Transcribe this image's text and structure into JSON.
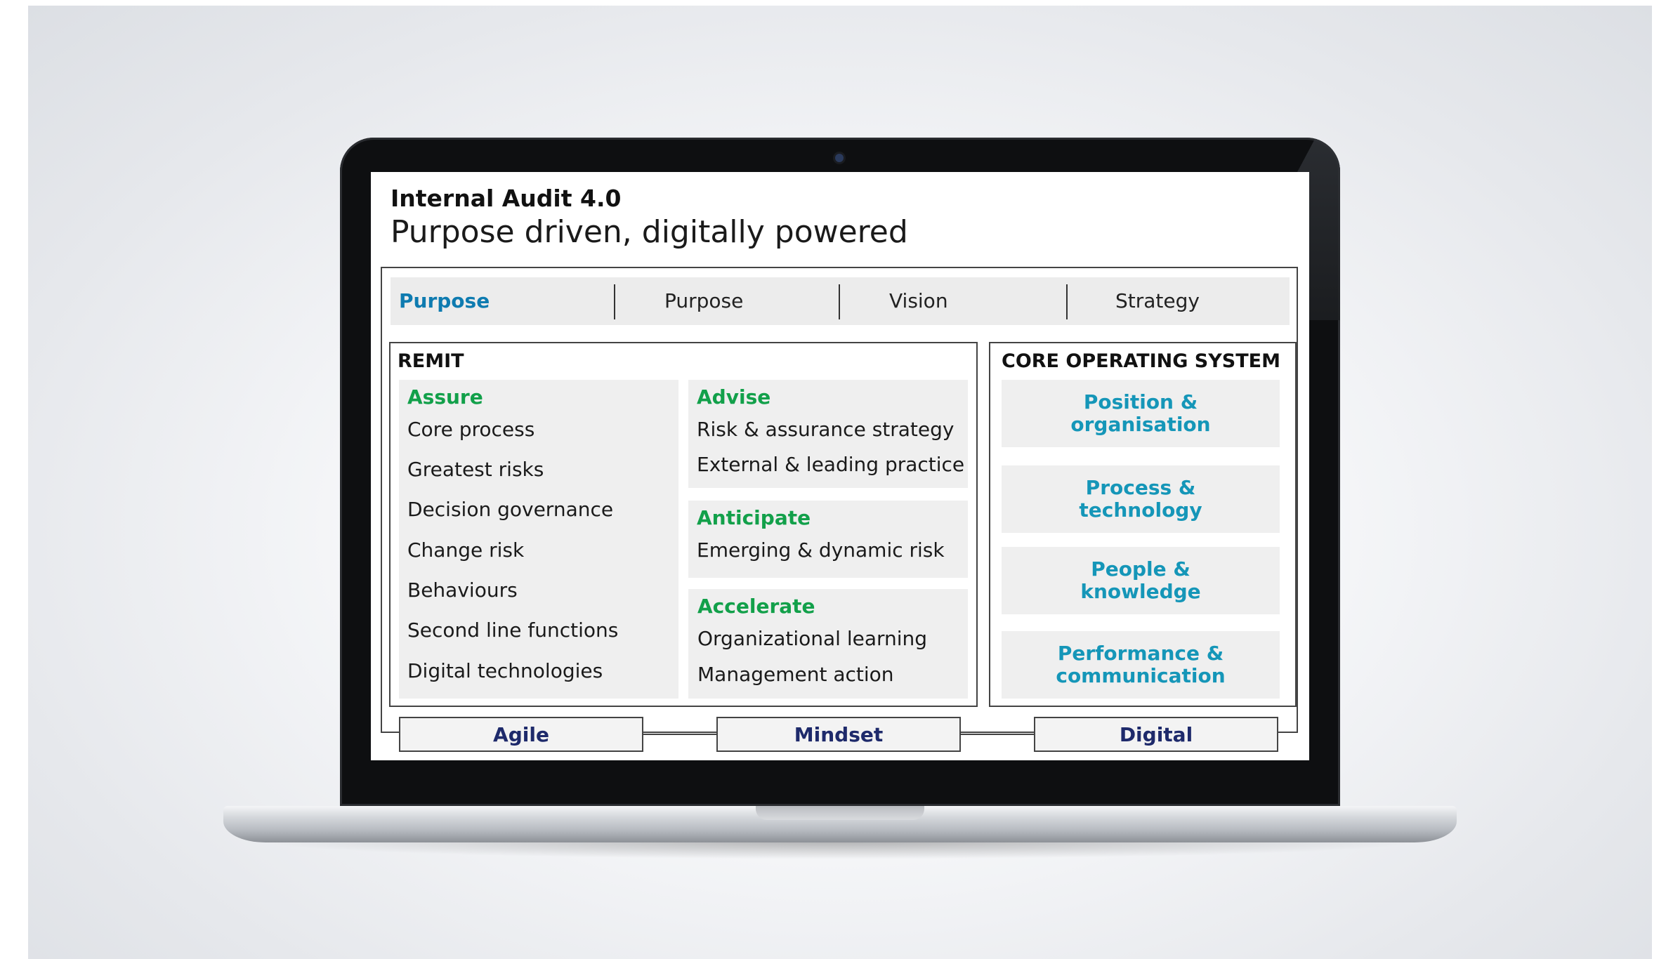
{
  "header": {
    "title": "Internal Audit 4.0",
    "subtitle": "Purpose driven, digitally powered"
  },
  "purpose_bar": {
    "items": [
      "Purpose",
      "Purpose",
      "Vision",
      "Strategy"
    ]
  },
  "remit": {
    "title": "REMIT",
    "assure": {
      "label": "Assure",
      "items": [
        "Core process",
        "Greatest risks",
        "Decision governance",
        "Change risk",
        "Behaviours",
        "Second line functions",
        "Digital technologies"
      ]
    },
    "advise": {
      "label": "Advise",
      "items": [
        "Risk & assurance strategy",
        "External & leading practice"
      ]
    },
    "anticipate": {
      "label": "Anticipate",
      "items": [
        "Emerging & dynamic risk"
      ]
    },
    "accelerate": {
      "label": "Accelerate",
      "items": [
        "Organizational learning",
        "Management action"
      ]
    }
  },
  "core_operating_system": {
    "title": "CORE OPERATING SYSTEM",
    "cards": [
      {
        "line1": "Position &",
        "line2": "organisation"
      },
      {
        "line1": "Process &",
        "line2": "technology"
      },
      {
        "line1": "People &",
        "line2": "knowledge"
      },
      {
        "line1": "Performance &",
        "line2": "communication"
      }
    ]
  },
  "foundation": {
    "items": [
      "Agile",
      "Mindset",
      "Digital"
    ]
  },
  "colors": {
    "purpose_accent": "#0e7bb0",
    "category_green": "#12a04a",
    "card_teal": "#1596b8",
    "foundation_navy": "#1e2a6b",
    "panel_gray": "#efefef"
  }
}
